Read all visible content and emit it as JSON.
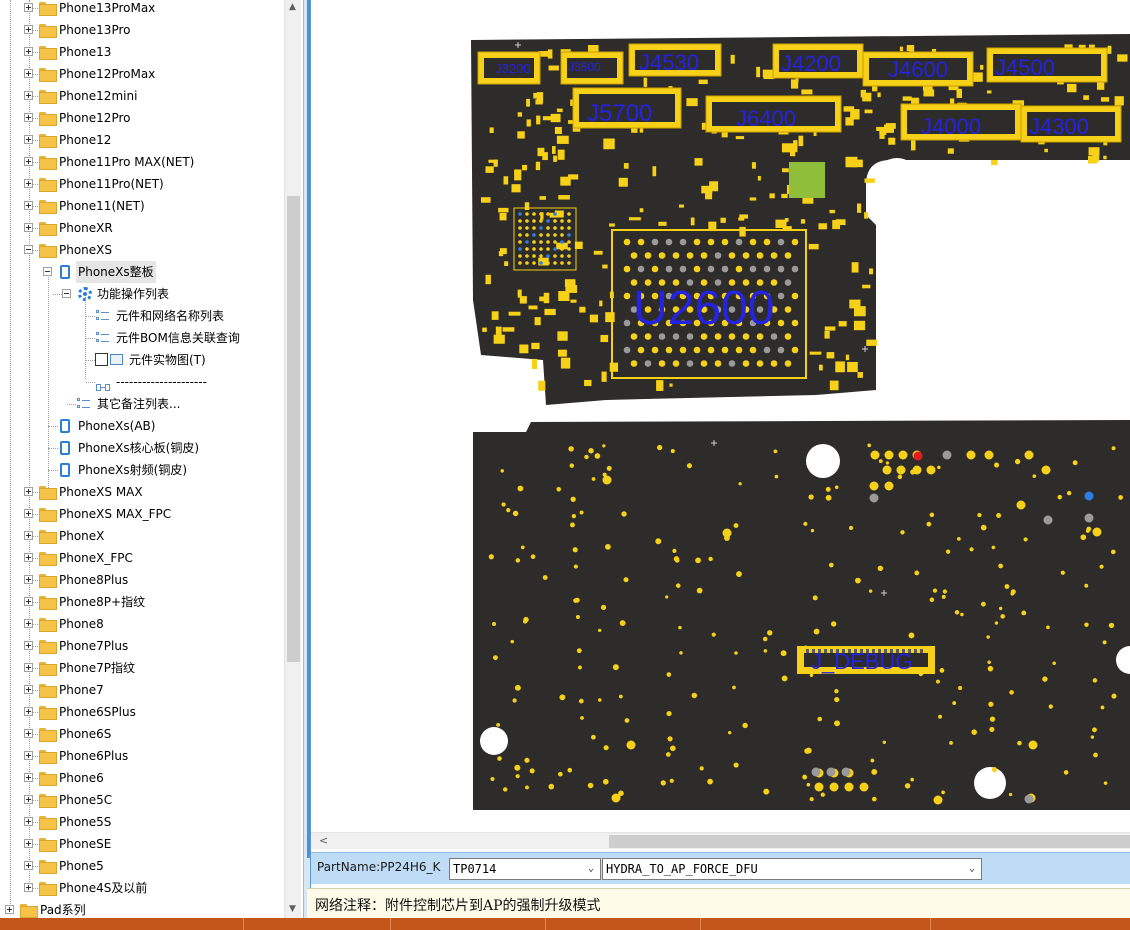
{
  "tree": {
    "top_items": [
      {
        "label": "Phone13ProMax"
      },
      {
        "label": "Phone13Pro"
      },
      {
        "label": "Phone13"
      },
      {
        "label": "Phone12ProMax"
      },
      {
        "label": "Phone12mini"
      },
      {
        "label": "Phone12Pro"
      },
      {
        "label": "Phone12"
      },
      {
        "label": "Phone11Pro MAX(NET)"
      },
      {
        "label": "Phone11Pro(NET)"
      },
      {
        "label": "Phone11(NET)"
      },
      {
        "label": "PhoneXR"
      }
    ],
    "expanded": {
      "label": "PhoneXS",
      "child_board": "PhoneXs整板",
      "function_group": "功能操作列表",
      "functions": [
        "元件和网络名称列表",
        "元件BOM信息关联查询",
        "元件实物图(T)",
        "---------------------"
      ],
      "other_notes": "其它备注列表...",
      "siblings": [
        "PhoneXs(AB)",
        "PhoneXs核心板(铜皮)",
        "PhoneXs射频(铜皮)"
      ]
    },
    "bottom_items": [
      {
        "label": "PhoneXS MAX"
      },
      {
        "label": "PhoneXS MAX_FPC"
      },
      {
        "label": "PhoneX"
      },
      {
        "label": "PhoneX_FPC"
      },
      {
        "label": "Phone8Plus"
      },
      {
        "label": "Phone8P+指纹"
      },
      {
        "label": "Phone8"
      },
      {
        "label": "Phone7Plus"
      },
      {
        "label": "Phone7P指纹"
      },
      {
        "label": "Phone7"
      },
      {
        "label": "Phone6SPlus"
      },
      {
        "label": "Phone6S"
      },
      {
        "label": "Phone6Plus"
      },
      {
        "label": "Phone6"
      },
      {
        "label": "Phone5C"
      },
      {
        "label": "Phone5S"
      },
      {
        "label": "PhoneSE"
      },
      {
        "label": "Phone5"
      },
      {
        "label": "Phone4S及以前"
      }
    ],
    "root_sibling": "Pad系列"
  },
  "board": {
    "connectors": [
      "J3200",
      "J3500",
      "J4530",
      "J4200",
      "J4600",
      "J4500",
      "J5700",
      "J6400",
      "J4000",
      "J4300"
    ],
    "main_chip": "U2600",
    "debug_connector": "J_DEBUG",
    "colors": {
      "pcb": "#2e2b2b",
      "pad": "#f7d117",
      "label": "#2323e0",
      "probe": "#2f7de0",
      "selected": "#e21c1c",
      "via": "#9a9a9a"
    }
  },
  "part_bar": {
    "part_name": "PartName:PP24H6_K",
    "testpoint": "TP0714",
    "net": "HYDRA_TO_AP_FORCE_DFU"
  },
  "note": "网络注释：附件控制芯片到AP的强制升级模式"
}
